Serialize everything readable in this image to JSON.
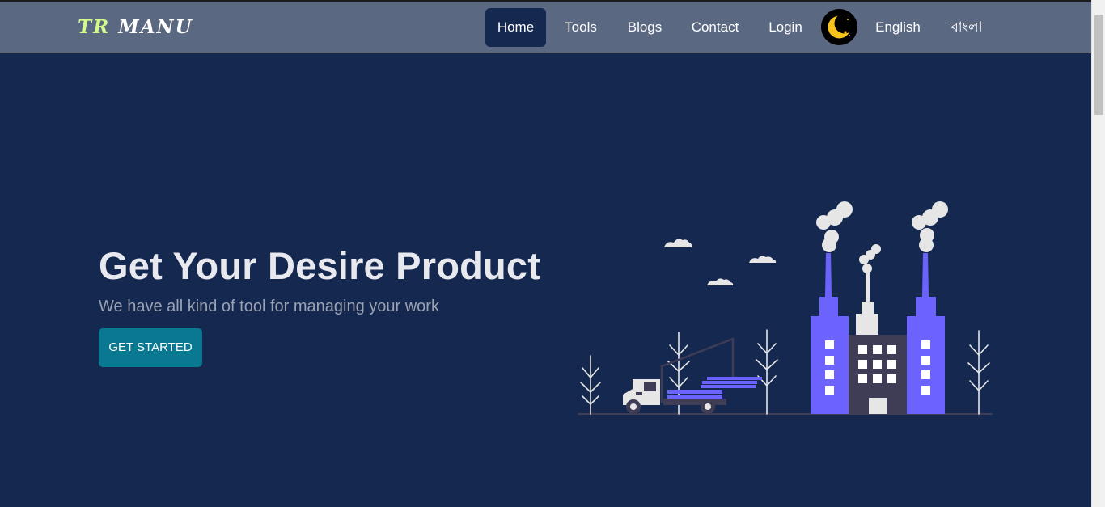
{
  "brand": {
    "part1": "TR",
    "part2": "MANU"
  },
  "nav": {
    "items": [
      {
        "label": "Home",
        "active": true
      },
      {
        "label": "Tools",
        "active": false
      },
      {
        "label": "Blogs",
        "active": false
      },
      {
        "label": "Contact",
        "active": false
      },
      {
        "label": "Login",
        "active": false
      }
    ],
    "theme_toggle_icon": "moon-icon",
    "languages": [
      "English",
      "বাংলা"
    ]
  },
  "hero": {
    "title": "Get Your Desire Product",
    "subtitle": "We have all kind of tool for managing your work",
    "cta_label": "GET STARTED",
    "illustration_icon": "factory-illustration"
  },
  "colors": {
    "navbar_bg": "#5b6882",
    "page_bg": "#15284f",
    "brand_accent": "#d3fb8c",
    "cta_bg": "#0b7891",
    "factory_purple": "#6c63ff",
    "moon_yellow": "#f7c31c"
  }
}
